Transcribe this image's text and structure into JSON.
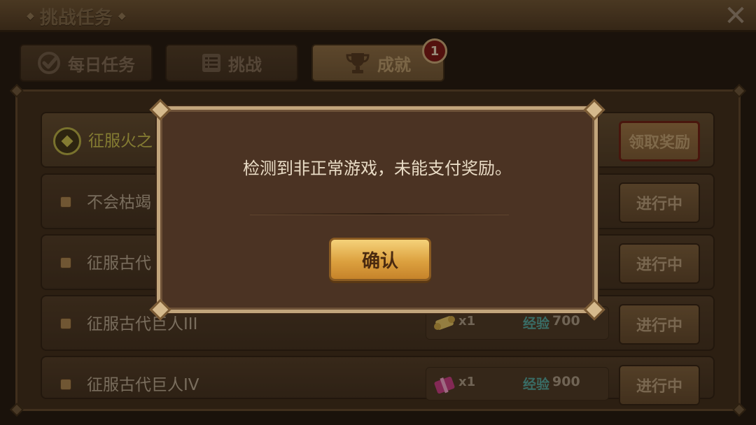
{
  "header": {
    "title": "挑战任务",
    "close_icon": "close-icon"
  },
  "tabs": [
    {
      "label": "每日任务",
      "icon": "checkmark-circle-icon",
      "active": false
    },
    {
      "label": "挑战",
      "icon": "list-icon",
      "active": false
    },
    {
      "label": "成就",
      "icon": "trophy-icon",
      "active": true,
      "badge": "1"
    }
  ],
  "achievements": [
    {
      "label": "征服火之",
      "status": "领取奖励",
      "claimable": true
    },
    {
      "label": "不会枯竭",
      "status": "进行中",
      "claimable": false
    },
    {
      "label": "征服古代",
      "status": "进行中",
      "claimable": false
    },
    {
      "label": "征服古代巨人III",
      "status": "进行中",
      "reward_qty": "x1",
      "exp_label": "经验",
      "exp_value": "700",
      "reward_icon": "scroll-icon"
    },
    {
      "label": "征服古代巨人IV",
      "status": "进行中",
      "reward_qty": "x1",
      "exp_label": "经验",
      "exp_value": "900",
      "reward_icon": "gift-icon"
    }
  ],
  "dialog": {
    "message": "检测到非正常游戏，未能支付奖励。",
    "confirm_label": "确认"
  },
  "colors": {
    "accent_gold": "#dca13f",
    "exp_teal": "#4fa7a1",
    "highlight_yellow": "#c8c04e",
    "badge_red": "#7a1414"
  }
}
